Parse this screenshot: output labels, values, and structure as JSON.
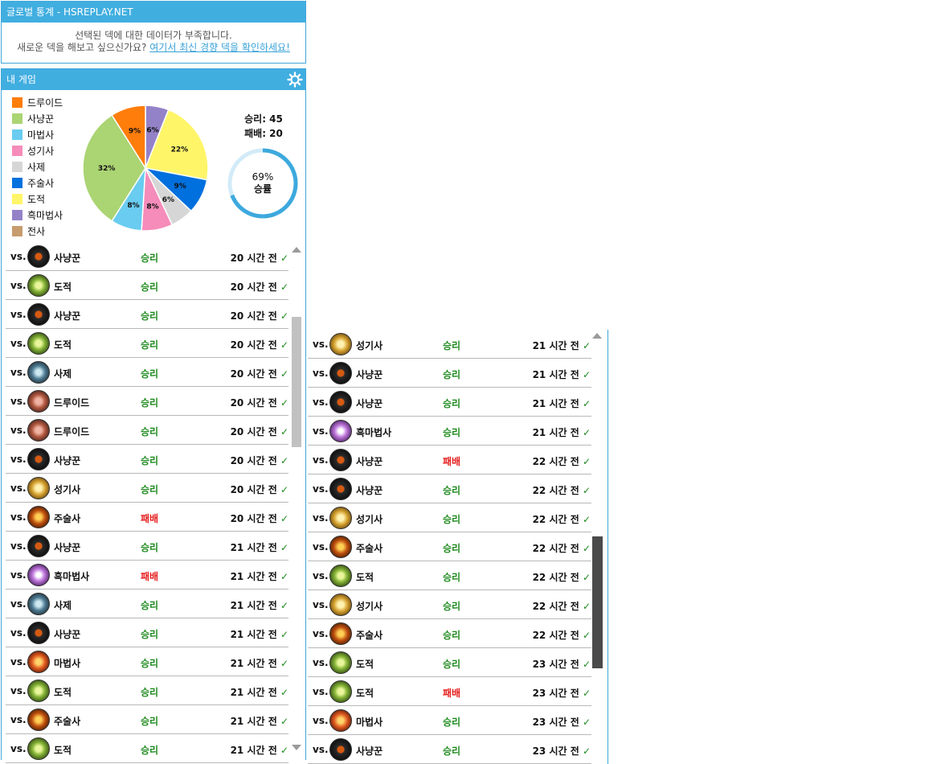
{
  "global_panel": {
    "title": "글로벌 통계 - HSREPLAY.NET",
    "line1": "선택된 덱에 대한 데이터가 부족합니다.",
    "line2_prefix": "새로운 덱을 해보고 싶으신가요?",
    "line2_link": "여기서 최신 경향 덱을 확인하세요!"
  },
  "games_panel": {
    "title": "내 게임",
    "settings_icon": "gear-icon",
    "legend": [
      {
        "label": "드루이드",
        "color": "#ff7d0a"
      },
      {
        "label": "사냥꾼",
        "color": "#abd473"
      },
      {
        "label": "마법사",
        "color": "#69ccf0"
      },
      {
        "label": "성기사",
        "color": "#f58cba"
      },
      {
        "label": "사제",
        "color": "#d6d6d6"
      },
      {
        "label": "주술사",
        "color": "#0070de"
      },
      {
        "label": "도적",
        "color": "#fff569"
      },
      {
        "label": "흑마법사",
        "color": "#9482c9"
      },
      {
        "label": "전사",
        "color": "#c79c6e"
      }
    ],
    "wins_label": "승리: 45",
    "losses_label": "패배: 20",
    "winrate_value": "69%",
    "winrate_label": "승률",
    "winrate_fraction": 0.69
  },
  "chart_data": {
    "type": "pie",
    "slices": [
      {
        "label": "흑마법사",
        "value": 6,
        "text": "6%",
        "color": "#9482c9"
      },
      {
        "label": "도적",
        "value": 22,
        "text": "22%",
        "color": "#fff569"
      },
      {
        "label": "주술사",
        "value": 9,
        "text": "9%",
        "color": "#0070de"
      },
      {
        "label": "사제",
        "value": 6,
        "text": "6%",
        "color": "#d6d6d6"
      },
      {
        "label": "성기사",
        "value": 8,
        "text": "8%",
        "color": "#f58cba"
      },
      {
        "label": "마법사",
        "value": 8,
        "text": "8%",
        "color": "#69ccf0"
      },
      {
        "label": "사냥꾼",
        "value": 32,
        "text": "32%",
        "color": "#abd473"
      },
      {
        "label": "드루이드",
        "value": 9,
        "text": "9%",
        "color": "#ff7d0a"
      }
    ]
  },
  "vs_label": "vs.",
  "list1": [
    {
      "cls": "사냥꾼",
      "hero": "hunter",
      "result": "승리",
      "win": true,
      "time": "20 시간 전"
    },
    {
      "cls": "도적",
      "hero": "rogue",
      "result": "승리",
      "win": true,
      "time": "20 시간 전"
    },
    {
      "cls": "사냥꾼",
      "hero": "hunter",
      "result": "승리",
      "win": true,
      "time": "20 시간 전"
    },
    {
      "cls": "도적",
      "hero": "rogue",
      "result": "승리",
      "win": true,
      "time": "20 시간 전"
    },
    {
      "cls": "사제",
      "hero": "priest",
      "result": "승리",
      "win": true,
      "time": "20 시간 전"
    },
    {
      "cls": "드루이드",
      "hero": "druid",
      "result": "승리",
      "win": true,
      "time": "20 시간 전"
    },
    {
      "cls": "드루이드",
      "hero": "druid",
      "result": "승리",
      "win": true,
      "time": "20 시간 전"
    },
    {
      "cls": "사냥꾼",
      "hero": "hunter",
      "result": "승리",
      "win": true,
      "time": "20 시간 전"
    },
    {
      "cls": "성기사",
      "hero": "paladin",
      "result": "승리",
      "win": true,
      "time": "20 시간 전"
    },
    {
      "cls": "주술사",
      "hero": "shaman",
      "result": "패배",
      "win": false,
      "time": "20 시간 전"
    },
    {
      "cls": "사냥꾼",
      "hero": "hunter",
      "result": "승리",
      "win": true,
      "time": "21 시간 전"
    },
    {
      "cls": "흑마법사",
      "hero": "warlock",
      "result": "패배",
      "win": false,
      "time": "21 시간 전"
    },
    {
      "cls": "사제",
      "hero": "priest",
      "result": "승리",
      "win": true,
      "time": "21 시간 전"
    },
    {
      "cls": "사냥꾼",
      "hero": "hunter",
      "result": "승리",
      "win": true,
      "time": "21 시간 전"
    },
    {
      "cls": "마법사",
      "hero": "mage",
      "result": "승리",
      "win": true,
      "time": "21 시간 전"
    },
    {
      "cls": "도적",
      "hero": "rogue",
      "result": "승리",
      "win": true,
      "time": "21 시간 전"
    },
    {
      "cls": "주술사",
      "hero": "shaman",
      "result": "승리",
      "win": true,
      "time": "21 시간 전"
    },
    {
      "cls": "도적",
      "hero": "rogue",
      "result": "승리",
      "win": true,
      "time": "21 시간 전"
    }
  ],
  "list2": [
    {
      "cls": "성기사",
      "hero": "paladin",
      "result": "승리",
      "win": true,
      "time": "21 시간 전"
    },
    {
      "cls": "사냥꾼",
      "hero": "hunter",
      "result": "승리",
      "win": true,
      "time": "21 시간 전"
    },
    {
      "cls": "사냥꾼",
      "hero": "hunter",
      "result": "승리",
      "win": true,
      "time": "21 시간 전"
    },
    {
      "cls": "흑마법사",
      "hero": "warlock",
      "result": "승리",
      "win": true,
      "time": "21 시간 전"
    },
    {
      "cls": "사냥꾼",
      "hero": "hunter",
      "result": "패배",
      "win": false,
      "time": "22 시간 전"
    },
    {
      "cls": "사냥꾼",
      "hero": "hunter",
      "result": "승리",
      "win": true,
      "time": "22 시간 전"
    },
    {
      "cls": "성기사",
      "hero": "paladin",
      "result": "승리",
      "win": true,
      "time": "22 시간 전"
    },
    {
      "cls": "주술사",
      "hero": "shaman",
      "result": "승리",
      "win": true,
      "time": "22 시간 전"
    },
    {
      "cls": "도적",
      "hero": "rogue",
      "result": "승리",
      "win": true,
      "time": "22 시간 전"
    },
    {
      "cls": "성기사",
      "hero": "paladin",
      "result": "승리",
      "win": true,
      "time": "22 시간 전"
    },
    {
      "cls": "주술사",
      "hero": "shaman",
      "result": "승리",
      "win": true,
      "time": "22 시간 전"
    },
    {
      "cls": "도적",
      "hero": "rogue",
      "result": "승리",
      "win": true,
      "time": "23 시간 전"
    },
    {
      "cls": "도적",
      "hero": "rogue",
      "result": "패배",
      "win": false,
      "time": "23 시간 전"
    },
    {
      "cls": "마법사",
      "hero": "mage",
      "result": "승리",
      "win": true,
      "time": "23 시간 전"
    },
    {
      "cls": "사냥꾼",
      "hero": "hunter",
      "result": "승리",
      "win": true,
      "time": "23 시간 전"
    }
  ],
  "check_mark": "✓"
}
